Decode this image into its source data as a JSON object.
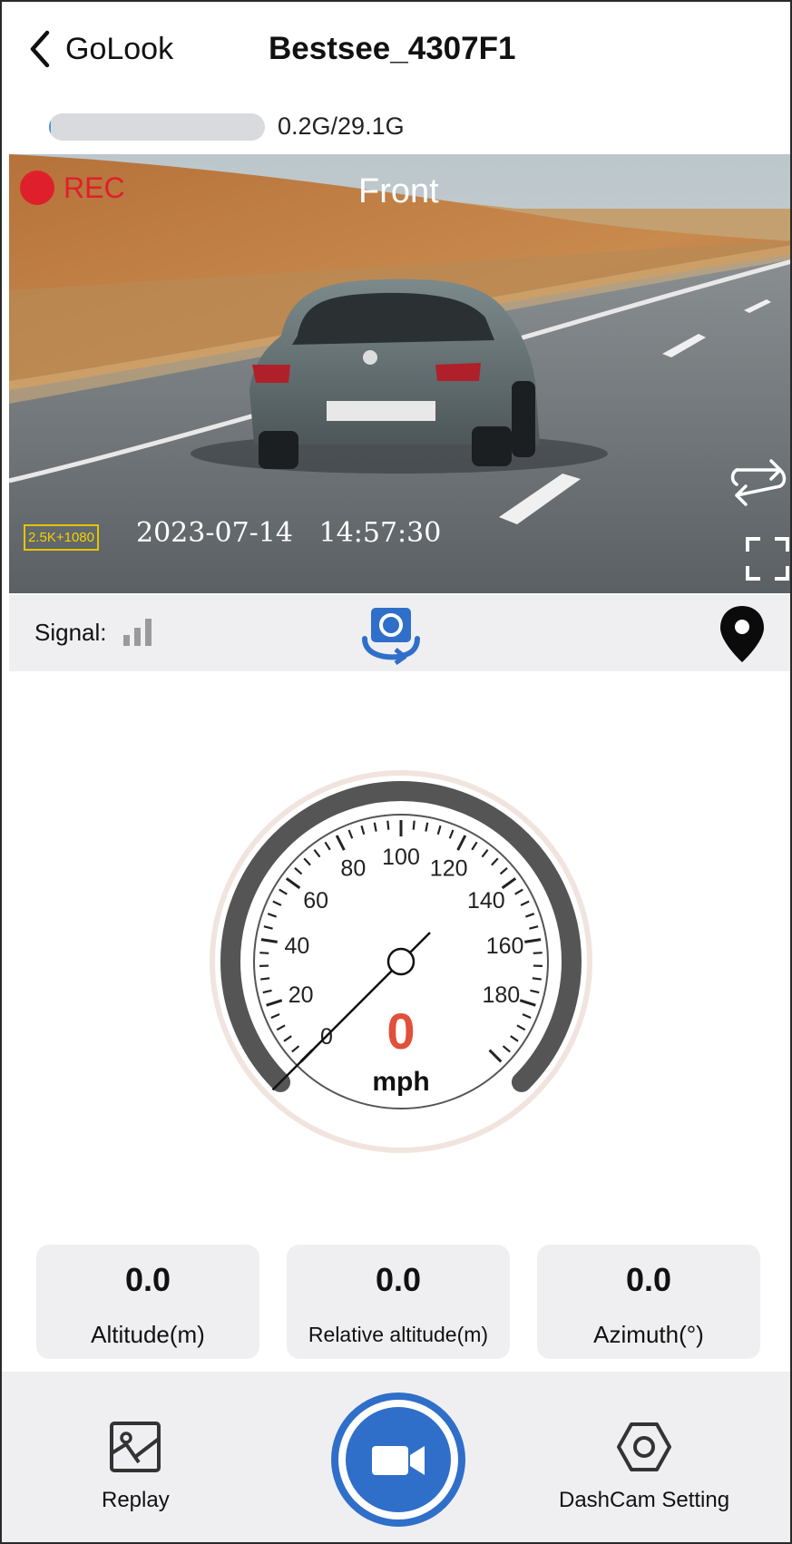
{
  "header": {
    "back_label": "GoLook",
    "title": "Bestsee_4307F1"
  },
  "storage": {
    "text": "0.2G/29.1G",
    "used_fraction": 0.007
  },
  "video": {
    "rec_label": "REC",
    "camera_label": "Front",
    "resolution_badge": "2.5K+1080",
    "timestamp": "2023-07-14   14:57:30"
  },
  "infobar": {
    "signal_label": "Signal:"
  },
  "speedometer": {
    "speed": "0",
    "unit": "mph",
    "tick_labels": [
      "0",
      "20",
      "40",
      "60",
      "80",
      "100",
      "120",
      "140",
      "160",
      "180"
    ],
    "max_value": 200
  },
  "stats": [
    {
      "value": "0.0",
      "label": "Altitude(m)"
    },
    {
      "value": "0.0",
      "label": "Relative altitude(m)"
    },
    {
      "value": "0.0",
      "label": "Azimuth(°)"
    }
  ],
  "bottom_nav": {
    "replay_label": "Replay",
    "settings_label": "DashCam Setting"
  },
  "colors": {
    "accent": "#2f6fc9",
    "rec": "#e01f2c",
    "speed": "#e0503a",
    "gauge_ring": "#555555"
  },
  "icons": {
    "back": "chevron-left-icon",
    "swap": "swap-camera-icon",
    "fullscreen": "fullscreen-icon",
    "signal": "signal-bars-icon",
    "snapshot": "rotate-camera-icon",
    "location": "location-pin-icon",
    "replay": "gallery-icon",
    "record": "video-camera-icon",
    "settings": "hex-nut-icon"
  }
}
